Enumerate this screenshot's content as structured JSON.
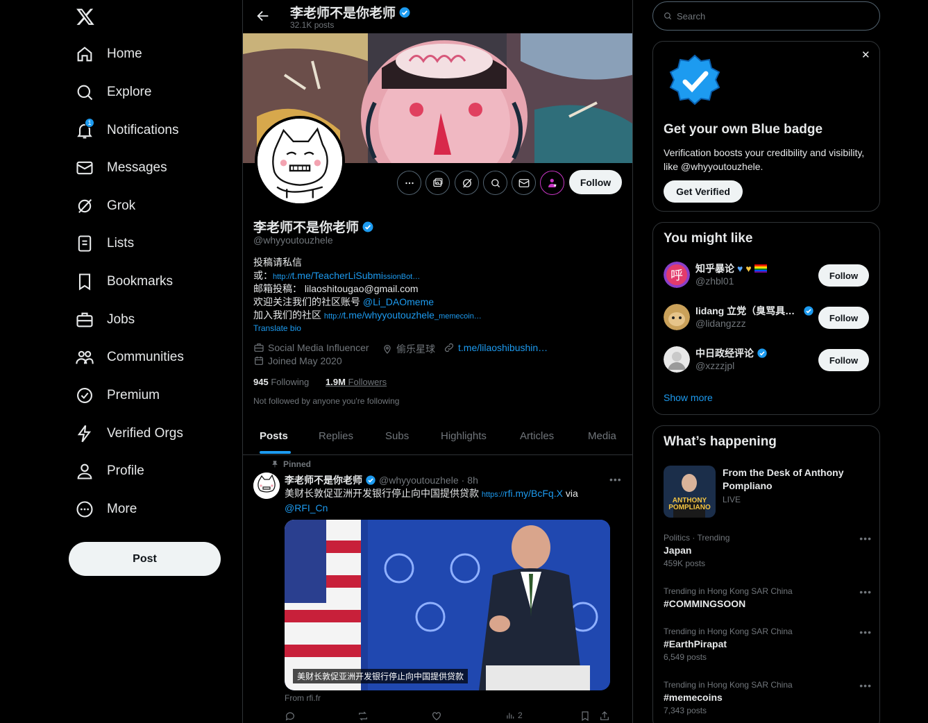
{
  "nav": {
    "items": [
      {
        "label": "Home",
        "icon": "home-icon"
      },
      {
        "label": "Explore",
        "icon": "search-icon"
      },
      {
        "label": "Notifications",
        "icon": "bell-icon",
        "badge": "1"
      },
      {
        "label": "Messages",
        "icon": "envelope-icon"
      },
      {
        "label": "Grok",
        "icon": "grok-icon"
      },
      {
        "label": "Lists",
        "icon": "list-icon"
      },
      {
        "label": "Bookmarks",
        "icon": "bookmark-icon"
      },
      {
        "label": "Jobs",
        "icon": "briefcase-icon"
      },
      {
        "label": "Communities",
        "icon": "people-icon"
      },
      {
        "label": "Premium",
        "icon": "premium-icon"
      },
      {
        "label": "Verified Orgs",
        "icon": "lightning-icon"
      },
      {
        "label": "Profile",
        "icon": "person-icon"
      },
      {
        "label": "More",
        "icon": "more-circle-icon"
      }
    ],
    "post_label": "Post"
  },
  "header": {
    "name": "李老师不是你老师",
    "posts": "32.1K posts"
  },
  "profile": {
    "name": "李老师不是你老师",
    "handle": "@whyyoutouzhele",
    "follow_label": "Follow",
    "bio": {
      "line1": "投稿请私信",
      "line2_prefix": "或：",
      "line2_link_a": "http://",
      "line2_link_b": "t.me/TeacherLiSubmi",
      "line2_link_c": "ssionBot…",
      "line3": "邮箱投稿： lilaoshitougao@gmail.com",
      "line4_prefix": "欢迎关注我们的社区账号 ",
      "line4_link": "@Li_DAOmeme",
      "line5_prefix": "加入我们的社区 ",
      "line5_link_a": "http://",
      "line5_link_b": "t.me/whyyoutouzhele",
      "line5_link_c": "_memecoin…"
    },
    "translate": "Translate bio",
    "category": "Social Media Influencer",
    "location": "偷乐星球",
    "website": "t.me/lilaoshibushin…",
    "joined": "Joined May 2020",
    "following_count": "945",
    "following_label": "Following",
    "followers_count": "1.9M",
    "followers_label": "Followers",
    "not_followed": "Not followed by anyone you're following"
  },
  "tabs": [
    "Posts",
    "Replies",
    "Subs",
    "Highlights",
    "Articles",
    "Media"
  ],
  "tweet": {
    "pinned_label": "Pinned",
    "name": "李老师不是你老师",
    "handle": "@whyyoutouzhele",
    "time": "8h",
    "text_main": "美财长敦促亚洲开发银行停止向中国提供贷款",
    "text_link_a": "https://",
    "text_link_b": "rfi.my/BcFq.X",
    "text_via": " via",
    "text_mention": "@RFI_Cn",
    "caption": "美财长敦促亚洲开发银行停止向中国提供贷款",
    "from": "From rfi.fr",
    "views": "2"
  },
  "search": {
    "placeholder": "Search"
  },
  "premium_card": {
    "title": "Get your own Blue badge",
    "desc": "Verification boosts your credibility and visibility, like @whyyoutouzhele.",
    "button": "Get Verified"
  },
  "might_like": {
    "title": "You might like",
    "users": [
      {
        "name": "知乎暴论",
        "handle": "@zhbl01",
        "button": "Follow"
      },
      {
        "name": "lidang 立党（臭骂具…",
        "handle": "@lidangzzz",
        "button": "Follow"
      },
      {
        "name": "中日政经评论",
        "handle": "@xzzzjpl",
        "button": "Follow"
      }
    ],
    "show_more": "Show more"
  },
  "happening": {
    "title": "What’s happening",
    "live": {
      "title": "From the Desk of Anthony Pompliano",
      "status": "LIVE",
      "thumb_text_1": "ANTHONY",
      "thumb_text_2": "POMPLIANO"
    },
    "trends": [
      {
        "meta": "Politics · Trending",
        "name": "Japan",
        "count": "459K posts"
      },
      {
        "meta": "Trending in Hong Kong SAR China",
        "name": "#COMMINGSOON",
        "count": ""
      },
      {
        "meta": "Trending in Hong Kong SAR China",
        "name": "#EarthPirapat",
        "count": "6,549 posts"
      },
      {
        "meta": "Trending in Hong Kong SAR China",
        "name": "#memecoins",
        "count": "7,343 posts"
      }
    ]
  },
  "colors": {
    "accent": "#1d9bf0",
    "bg": "#000000",
    "border": "#2f3336",
    "muted": "#71767b"
  }
}
